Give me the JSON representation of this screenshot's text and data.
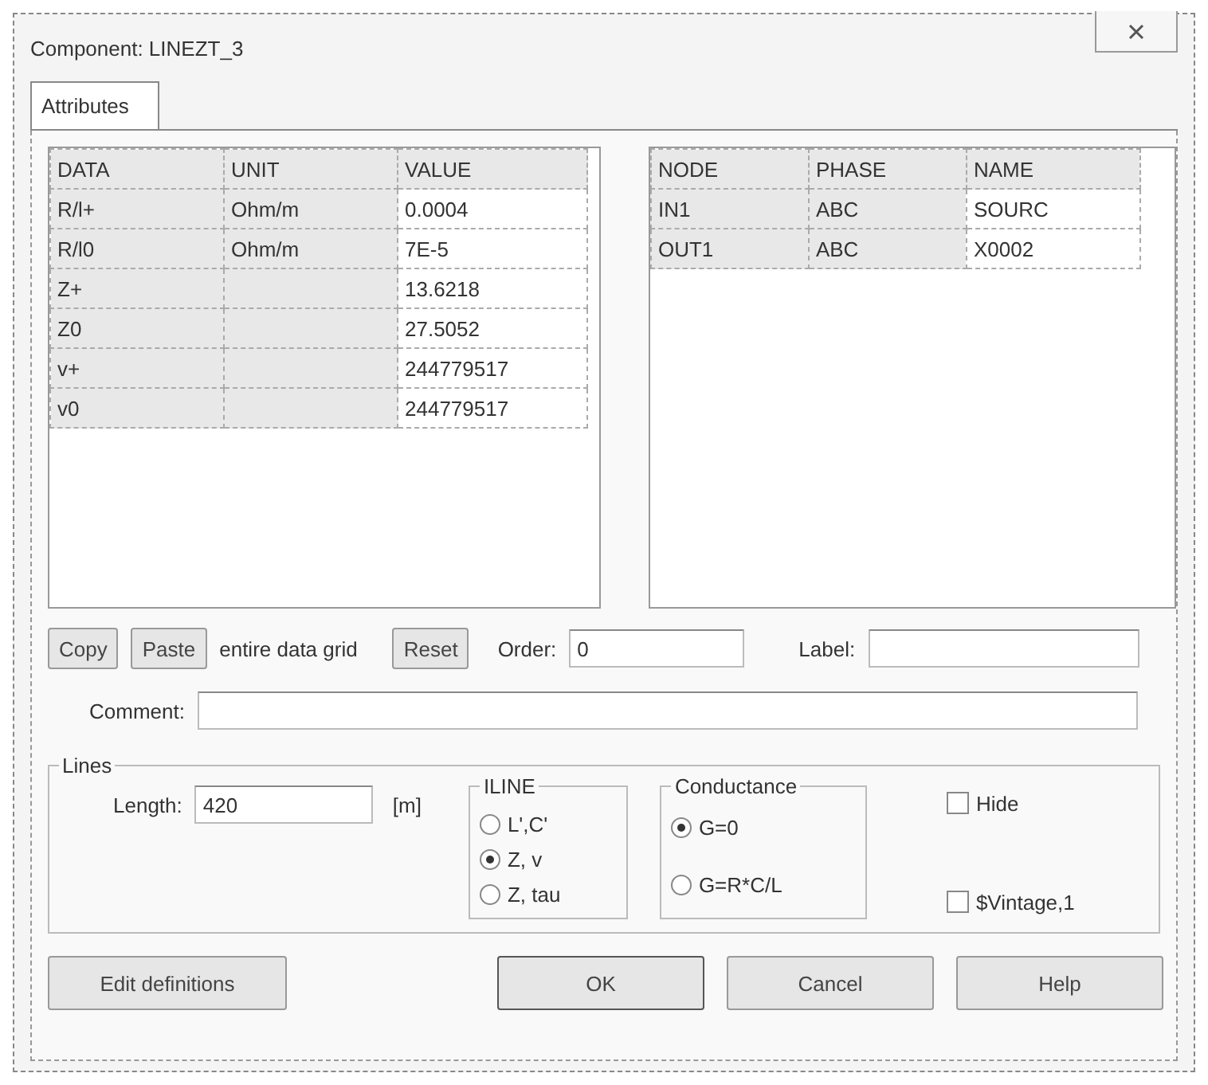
{
  "window": {
    "title": "Component: LINEZT_3"
  },
  "tabs": [
    {
      "label": "Attributes",
      "selected": true
    }
  ],
  "data_grid": {
    "columns": [
      "DATA",
      "UNIT",
      "VALUE"
    ],
    "rows": [
      [
        "R/l+",
        "Ohm/m",
        "0.0004"
      ],
      [
        "R/l0",
        "Ohm/m",
        "7E-5"
      ],
      [
        "Z+",
        "",
        "13.6218"
      ],
      [
        "Z0",
        "",
        "27.5052"
      ],
      [
        "v+",
        "",
        "244779517"
      ],
      [
        "v0",
        "",
        "244779517"
      ]
    ]
  },
  "node_grid": {
    "columns": [
      "NODE",
      "PHASE",
      "NAME"
    ],
    "rows": [
      [
        "IN1",
        "ABC",
        "SOURC"
      ],
      [
        "OUT1",
        "ABC",
        "X0002"
      ]
    ]
  },
  "grid_actions": {
    "copy": "Copy",
    "paste": "Paste",
    "note": "entire data grid",
    "reset": "Reset"
  },
  "order": {
    "label": "Order:",
    "value": "0"
  },
  "label_field": {
    "label": "Label:"
  },
  "comment": {
    "label": "Comment:"
  },
  "lines": {
    "title": "Lines",
    "length_label": "Length:",
    "length_value": "420",
    "unit": "[m]",
    "iline": {
      "title": "ILINE",
      "options": [
        {
          "label": "L',C'",
          "selected": false
        },
        {
          "label": "Z, v",
          "selected": true
        },
        {
          "label": "Z, tau",
          "selected": false
        }
      ]
    },
    "conductance": {
      "title": "Conductance",
      "options": [
        {
          "label": "G=0",
          "selected": true
        },
        {
          "label": "G=R*C/L",
          "selected": false
        }
      ]
    },
    "checks": [
      {
        "label": "Hide",
        "checked": false
      },
      {
        "label": "$Vintage,1",
        "checked": false
      }
    ]
  },
  "buttons": [
    "Edit definitions",
    "OK",
    "Cancel",
    "Help"
  ]
}
